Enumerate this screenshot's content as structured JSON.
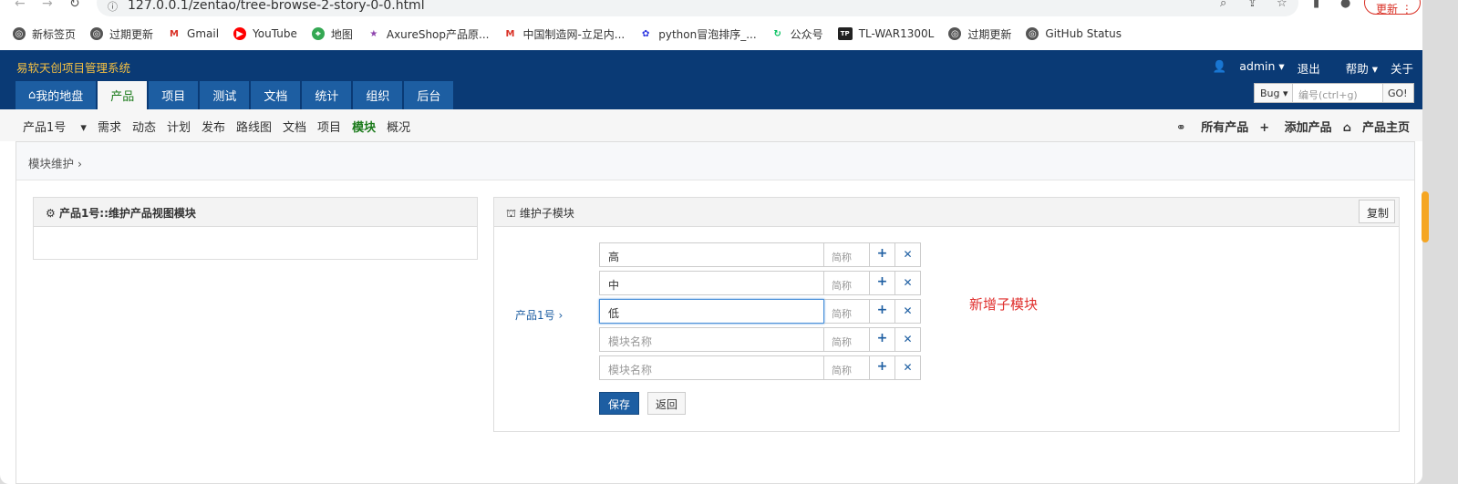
{
  "browser": {
    "url": "127.0.0.1/zentao/tree-browse-2-story-0-0.html",
    "update_label": "更新",
    "bookmarks": [
      {
        "label": "新标签页",
        "icon": "globe-icon"
      },
      {
        "label": "过期更新",
        "icon": "globe-icon"
      },
      {
        "label": "Gmail",
        "icon": "gmail-icon"
      },
      {
        "label": "YouTube",
        "icon": "youtube-icon"
      },
      {
        "label": "地图",
        "icon": "maps-icon"
      },
      {
        "label": "AxureShop产品原...",
        "icon": "star-icon"
      },
      {
        "label": "中国制造网-立足内...",
        "icon": "mic-icon"
      },
      {
        "label": "python冒泡排序_...",
        "icon": "baidu-icon"
      },
      {
        "label": "公众号",
        "icon": "refresh-icon"
      },
      {
        "label": "TL-WAR1300L",
        "icon": "tp-icon"
      },
      {
        "label": "过期更新",
        "icon": "globe-icon"
      },
      {
        "label": "GitHub Status",
        "icon": "globe-icon"
      }
    ]
  },
  "app": {
    "brand": "易软天创项目管理系统",
    "user": "admin",
    "logout": "退出",
    "help": "帮助",
    "about": "关于",
    "main_nav": [
      "我的地盘",
      "产品",
      "项目",
      "测试",
      "文档",
      "统计",
      "组织",
      "后台"
    ],
    "main_nav_active": 1,
    "search": {
      "type": "Bug",
      "placeholder": "编号(ctrl+g)",
      "go": "GO!"
    }
  },
  "subnav": {
    "product": "产品1号",
    "items": [
      "需求",
      "动态",
      "计划",
      "发布",
      "路线图",
      "文档",
      "项目",
      "模块",
      "概况"
    ],
    "active": "模块",
    "right": [
      "所有产品",
      "添加产品",
      "产品主页"
    ]
  },
  "page": {
    "breadcrumb": "模块维护",
    "left_title": "产品1号::维护产品视图模块",
    "right_title": "维护子模块",
    "copy": "复制",
    "product_link": "产品1号",
    "rows": [
      {
        "name": "高",
        "placeholder": "模块名称",
        "short": "简称",
        "focus": false
      },
      {
        "name": "中",
        "placeholder": "模块名称",
        "short": "简称",
        "focus": false
      },
      {
        "name": "低",
        "placeholder": "模块名称",
        "short": "简称",
        "focus": true
      },
      {
        "name": "",
        "placeholder": "模块名称",
        "short": "简称",
        "focus": false
      },
      {
        "name": "",
        "placeholder": "模块名称",
        "short": "简称",
        "focus": false
      }
    ],
    "save": "保存",
    "back": "返回",
    "annotation": "新增子模块"
  },
  "colors": {
    "header": "#0a3a75",
    "tab": "#1d5ea2",
    "brand": "#f5c042",
    "annotation": "#e0302e"
  }
}
